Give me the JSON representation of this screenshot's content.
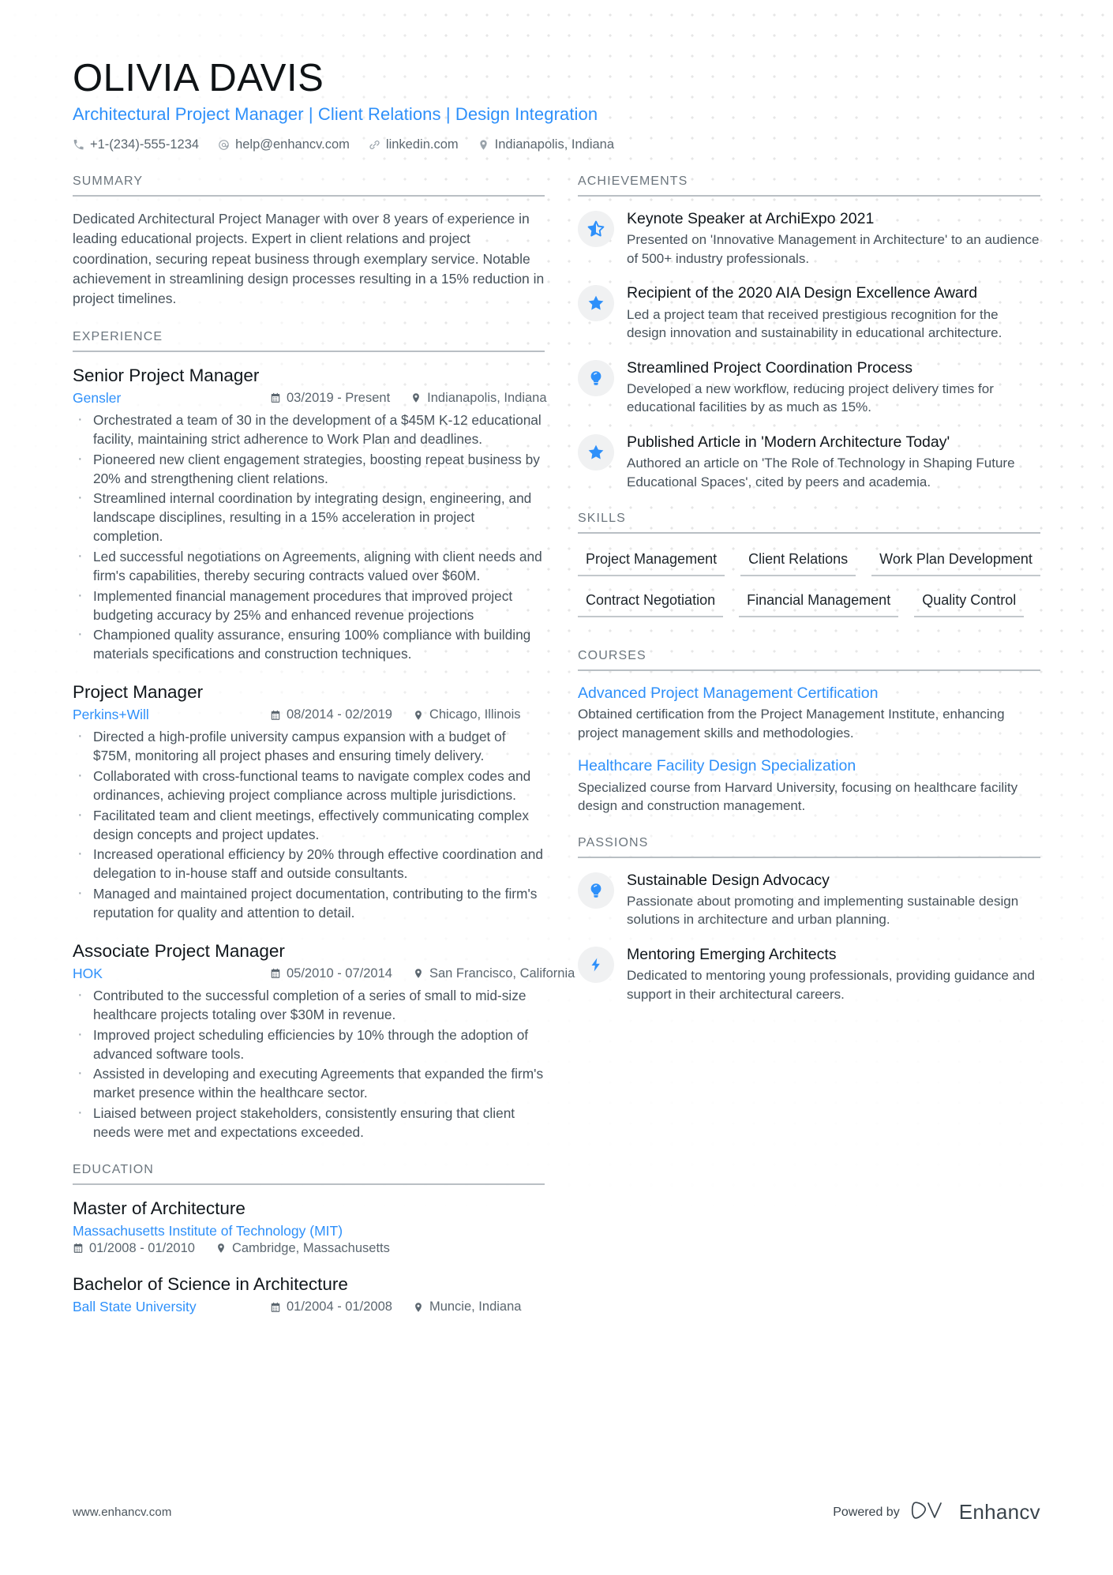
{
  "header": {
    "name": "OLIVIA DAVIS",
    "headline": "Architectural Project Manager | Client Relations | Design Integration",
    "contacts": [
      {
        "icon": "phone-icon",
        "text": "+1-(234)-555-1234"
      },
      {
        "icon": "email-icon",
        "text": "help@enhancv.com"
      },
      {
        "icon": "link-icon",
        "text": "linkedin.com"
      },
      {
        "icon": "location-pin-icon",
        "text": "Indianapolis, Indiana"
      }
    ]
  },
  "summary": {
    "title": "SUMMARY",
    "text": "Dedicated Architectural Project Manager with over 8 years of experience in leading educational projects. Expert in client relations and project coordination, securing repeat business through exemplary service. Notable achievement in streamlining design processes resulting in a 15% reduction in project timelines."
  },
  "experience": {
    "title": "EXPERIENCE",
    "entries": [
      {
        "role": "Senior Project Manager",
        "org": "Gensler",
        "dates": "03/2019 - Present",
        "location": "Indianapolis, Indiana",
        "bullets": [
          "Orchestrated a team of 30 in the development of a $45M K-12 educational facility, maintaining strict adherence to Work Plan and deadlines.",
          "Pioneered new client engagement strategies, boosting repeat business by 20% and strengthening client relations.",
          "Streamlined internal coordination by integrating design, engineering, and landscape disciplines, resulting in a 15% acceleration in project completion.",
          "Led successful negotiations on Agreements, aligning with client needs and firm's capabilities, thereby securing contracts valued over $60M.",
          "Implemented financial management procedures that improved project budgeting accuracy by 25% and enhanced revenue projections",
          "Championed quality assurance, ensuring 100% compliance with building materials specifications and construction techniques."
        ]
      },
      {
        "role": "Project Manager",
        "org": "Perkins+Will",
        "dates": "08/2014 - 02/2019",
        "location": "Chicago, Illinois",
        "bullets": [
          "Directed a high-profile university campus expansion with a budget of $75M, monitoring all project phases and ensuring timely delivery.",
          "Collaborated with cross-functional teams to navigate complex codes and ordinances, achieving project compliance across multiple jurisdictions.",
          "Facilitated team and client meetings, effectively communicating complex design concepts and project updates.",
          "Increased operational efficiency by 20% through effective coordination and delegation to in-house staff and outside consultants.",
          "Managed and maintained project documentation, contributing to the firm's reputation for quality and attention to detail."
        ]
      },
      {
        "role": "Associate Project Manager",
        "org": "HOK",
        "dates": "05/2010 - 07/2014",
        "location": "San Francisco, California",
        "bullets": [
          "Contributed to the successful completion of a series of small to mid-size healthcare projects totaling over $30M in revenue.",
          "Improved project scheduling efficiencies by 10% through the adoption of advanced software tools.",
          "Assisted in developing and executing Agreements that expanded the firm's market presence within the healthcare sector.",
          "Liaised between project stakeholders, consistently ensuring that client needs were met and expectations exceeded."
        ]
      }
    ]
  },
  "education": {
    "title": "EDUCATION",
    "entries": [
      {
        "degree": "Master of Architecture",
        "school": "Massachusetts Institute of Technology (MIT)",
        "dates": "01/2008 - 01/2010",
        "location": "Cambridge, Massachusetts",
        "stacked": true
      },
      {
        "degree": "Bachelor of Science in Architecture",
        "school": "Ball State University",
        "dates": "01/2004 - 01/2008",
        "location": "Muncie, Indiana",
        "stacked": false
      }
    ]
  },
  "achievements": {
    "title": "ACHIEVEMENTS",
    "items": [
      {
        "icon": "star-half-icon",
        "title": "Keynote Speaker at ArchiExpo 2021",
        "desc": "Presented on 'Innovative Management in Architecture' to an audience of 500+ industry professionals."
      },
      {
        "icon": "star-icon",
        "title": "Recipient of the 2020 AIA Design Excellence Award",
        "desc": "Led a project team that received prestigious recognition for the design innovation and sustainability in educational architecture."
      },
      {
        "icon": "lightbulb-icon",
        "title": "Streamlined Project Coordination Process",
        "desc": "Developed a new workflow, reducing project delivery times for educational facilities by as much as 15%."
      },
      {
        "icon": "star-icon",
        "title": "Published Article in 'Modern Architecture Today'",
        "desc": "Authored an article on 'The Role of Technology in Shaping Future Educational Spaces', cited by peers and academia."
      }
    ]
  },
  "skills": {
    "title": "SKILLS",
    "items": [
      "Project Management",
      "Client Relations",
      "Work Plan Development",
      "Contract Negotiation",
      "Financial Management",
      "Quality Control"
    ]
  },
  "courses": {
    "title": "COURSES",
    "items": [
      {
        "title": "Advanced Project Management Certification",
        "desc": "Obtained certification from the Project Management Institute, enhancing project management skills and methodologies."
      },
      {
        "title": "Healthcare Facility Design Specialization",
        "desc": "Specialized course from Harvard University, focusing on healthcare facility design and construction management."
      }
    ]
  },
  "passions": {
    "title": "PASSIONS",
    "items": [
      {
        "icon": "lightbulb-icon",
        "title": "Sustainable Design Advocacy",
        "desc": "Passionate about promoting and implementing sustainable design solutions in architecture and urban planning."
      },
      {
        "icon": "lightning-bolt-icon",
        "title": "Mentoring Emerging Architects",
        "desc": "Dedicated to mentoring young professionals, providing guidance and support in their architectural careers."
      }
    ]
  },
  "footer": {
    "url": "www.enhancv.com",
    "powered_by": "Powered by",
    "brand": "Enhancv"
  },
  "colors": {
    "accent": "#2e90fa",
    "heading": "#10161b",
    "body": "#47525b",
    "muted": "#6c767e",
    "badge_bg": "#f0f1f2"
  }
}
